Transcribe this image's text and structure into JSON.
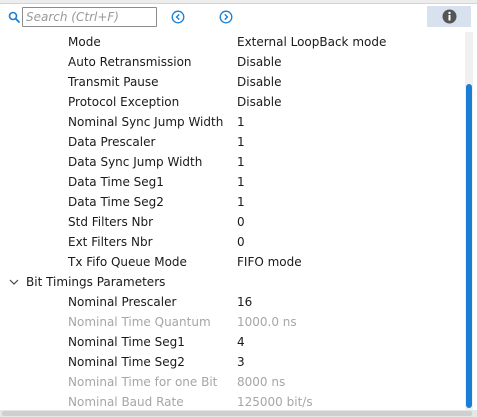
{
  "search": {
    "placeholder": "Search (Ctrl+F)",
    "value": ""
  },
  "toolbar": {
    "back_icon": "circle-arrow-left-icon",
    "forward_icon": "circle-arrow-right-icon",
    "info_icon": "info-icon",
    "accent_color": "#1a7fd4"
  },
  "rows": [
    {
      "name": "Mode",
      "value": "External LoopBack mode",
      "enabled": true
    },
    {
      "name": "Auto Retransmission",
      "value": "Disable",
      "enabled": true
    },
    {
      "name": "Transmit Pause",
      "value": "Disable",
      "enabled": true
    },
    {
      "name": "Protocol Exception",
      "value": "Disable",
      "enabled": true
    },
    {
      "name": "Nominal Sync Jump Width",
      "value": "1",
      "enabled": true
    },
    {
      "name": "Data Prescaler",
      "value": "1",
      "enabled": true
    },
    {
      "name": "Data Sync Jump Width",
      "value": "1",
      "enabled": true
    },
    {
      "name": "Data Time Seg1",
      "value": "1",
      "enabled": true
    },
    {
      "name": "Data Time Seg2",
      "value": "1",
      "enabled": true
    },
    {
      "name": "Std Filters Nbr",
      "value": "0",
      "enabled": true
    },
    {
      "name": "Ext Filters Nbr",
      "value": "0",
      "enabled": true
    },
    {
      "name": "Tx Fifo Queue Mode",
      "value": "FIFO mode",
      "enabled": true
    }
  ],
  "group": {
    "label": "Bit Timings Parameters",
    "expanded": true,
    "rows": [
      {
        "name": "Nominal Prescaler",
        "value": "16",
        "enabled": true
      },
      {
        "name": "Nominal Time Quantum",
        "value": "1000.0 ns",
        "enabled": false
      },
      {
        "name": "Nominal Time Seg1",
        "value": "4",
        "enabled": true
      },
      {
        "name": "Nominal Time Seg2",
        "value": "3",
        "enabled": true
      },
      {
        "name": "Nominal Time for one Bit",
        "value": "8000 ns",
        "enabled": false
      },
      {
        "name": "Nominal Baud Rate",
        "value": "125000 bit/s",
        "enabled": false
      }
    ]
  }
}
